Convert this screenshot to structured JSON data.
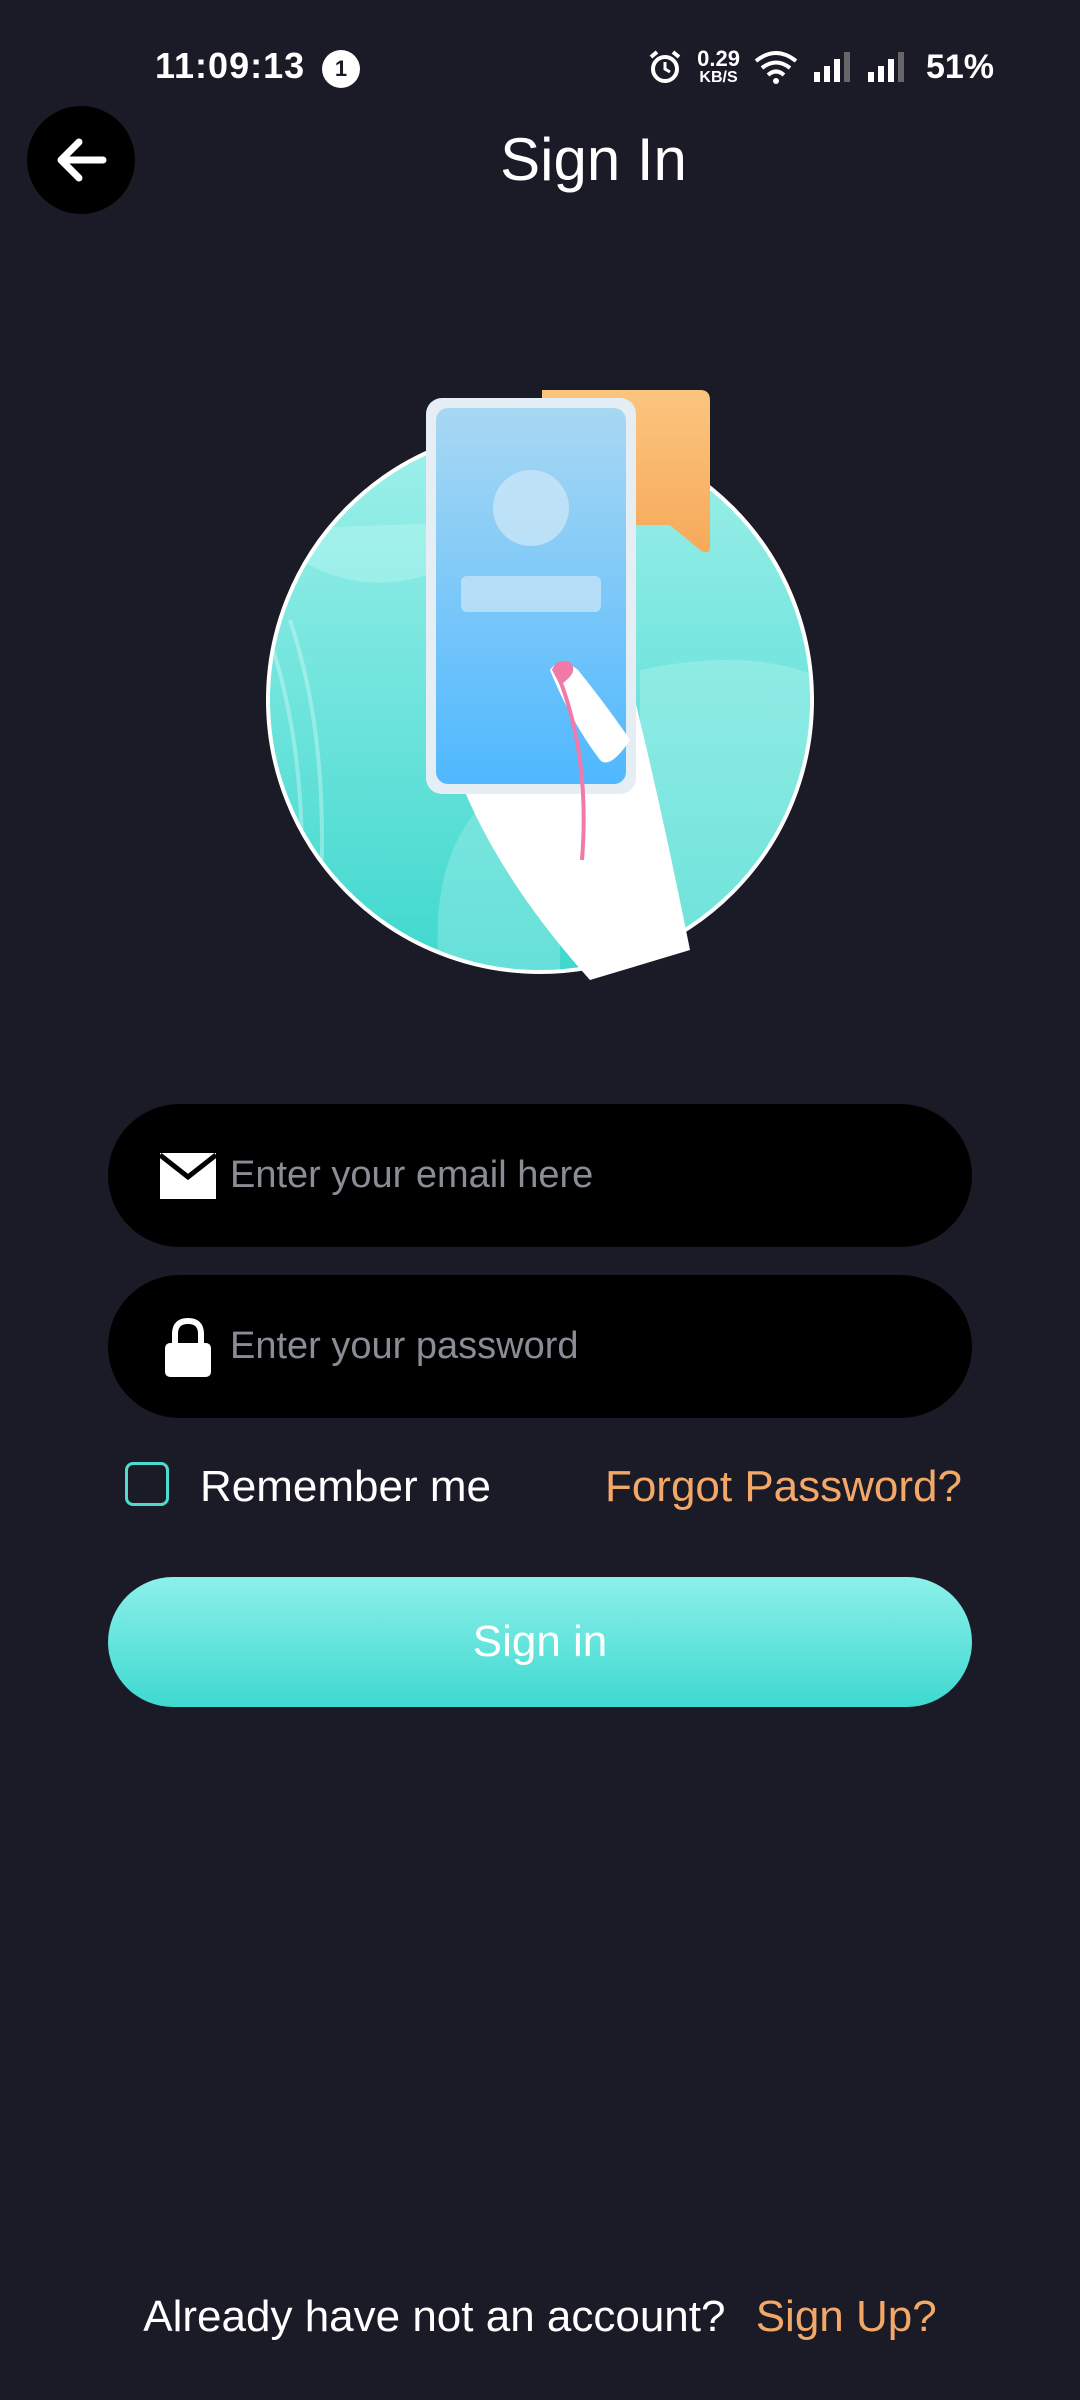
{
  "status_bar": {
    "time": "11:09:13",
    "notification_count": "1",
    "net_speed_value": "0.29",
    "net_speed_unit": "KB/S",
    "battery": "51%"
  },
  "header": {
    "title": "Sign In",
    "back_icon": "arrow-left-icon"
  },
  "form": {
    "email": {
      "placeholder": "Enter your email here",
      "value": "",
      "icon": "mail-icon"
    },
    "password": {
      "placeholder": "Enter your password",
      "value": "",
      "icon": "lock-icon"
    },
    "remember_label": "Remember me",
    "remember_checked": false,
    "forgot_label": "Forgot Password?",
    "submit_label": "Sign in"
  },
  "footer": {
    "question": "Already have not an account?",
    "signup_label": "Sign Up?"
  },
  "colors": {
    "background": "#1a1b26",
    "accent_teal": "#3ed9d0",
    "accent_orange": "#f4a868",
    "field_bg": "#000000"
  }
}
